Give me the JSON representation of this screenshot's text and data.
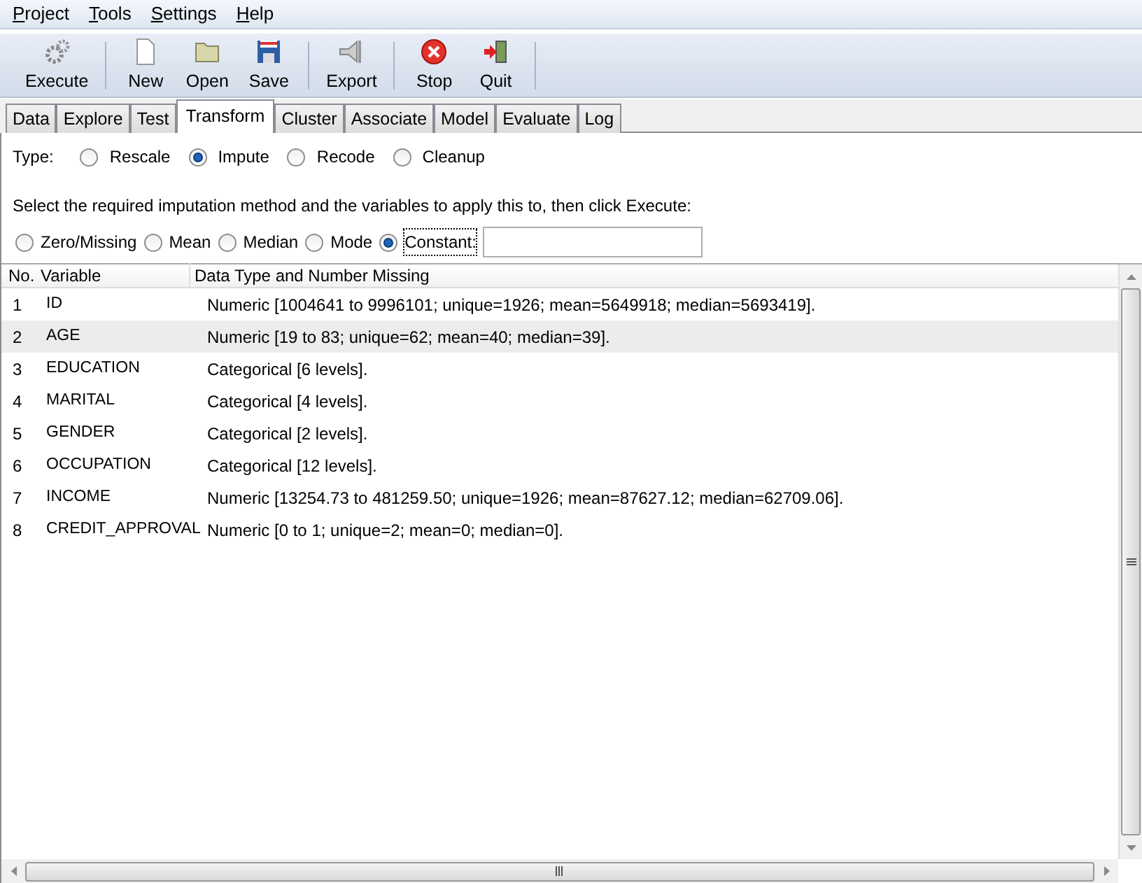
{
  "menu": [
    "Project",
    "Tools",
    "Settings",
    "Help"
  ],
  "toolbar": [
    {
      "label": "Execute",
      "kind": "execute"
    },
    {
      "label": "New",
      "kind": "new"
    },
    {
      "label": "Open",
      "kind": "open"
    },
    {
      "label": "Save",
      "kind": "save"
    },
    {
      "label": "Export",
      "kind": "export"
    },
    {
      "label": "Stop",
      "kind": "stop"
    },
    {
      "label": "Quit",
      "kind": "quit"
    }
  ],
  "tabs": [
    {
      "label": "Data",
      "selected": false
    },
    {
      "label": "Explore",
      "selected": false
    },
    {
      "label": "Test",
      "selected": false
    },
    {
      "label": "Transform",
      "selected": true
    },
    {
      "label": "Cluster",
      "selected": false
    },
    {
      "label": "Associate",
      "selected": false
    },
    {
      "label": "Model",
      "selected": false
    },
    {
      "label": "Evaluate",
      "selected": false
    },
    {
      "label": "Log",
      "selected": false
    }
  ],
  "type_label": "Type:",
  "types": [
    {
      "label": "Rescale",
      "selected": false
    },
    {
      "label": "Impute",
      "selected": true
    },
    {
      "label": "Recode",
      "selected": false
    },
    {
      "label": "Cleanup",
      "selected": false
    }
  ],
  "instruction": "Select the required imputation method and the variables to apply this to, then click Execute:",
  "methods": [
    {
      "label": "Zero/Missing",
      "selected": false
    },
    {
      "label": "Mean",
      "selected": false
    },
    {
      "label": "Median",
      "selected": false
    },
    {
      "label": "Mode",
      "selected": false
    },
    {
      "label": "Constant:",
      "selected": true
    }
  ],
  "table": {
    "columns": [
      "No.",
      "Variable",
      "Data Type and Number Missing"
    ],
    "rows": [
      {
        "no": "1",
        "variable": "ID",
        "info": "Numeric [1004641 to 9996101; unique=1926; mean=5649918; median=5693419].",
        "selected": false
      },
      {
        "no": "2",
        "variable": "AGE",
        "info": "Numeric [19 to 83; unique=62; mean=40; median=39].",
        "selected": true
      },
      {
        "no": "3",
        "variable": "EDUCATION",
        "info": "Categorical [6 levels].",
        "selected": false
      },
      {
        "no": "4",
        "variable": "MARITAL",
        "info": "Categorical [4 levels].",
        "selected": false
      },
      {
        "no": "5",
        "variable": "GENDER",
        "info": "Categorical [2 levels].",
        "selected": false
      },
      {
        "no": "6",
        "variable": "OCCUPATION",
        "info": "Categorical [12 levels].",
        "selected": false
      },
      {
        "no": "7",
        "variable": "INCOME",
        "info": "Numeric [13254.73 to 481259.50; unique=1926; mean=87627.12; median=62709.06].",
        "selected": false
      },
      {
        "no": "8",
        "variable": "CREDIT_APPROVAL",
        "info": "Numeric [0 to 1; unique=2; mean=0; median=0].",
        "selected": false
      }
    ]
  }
}
